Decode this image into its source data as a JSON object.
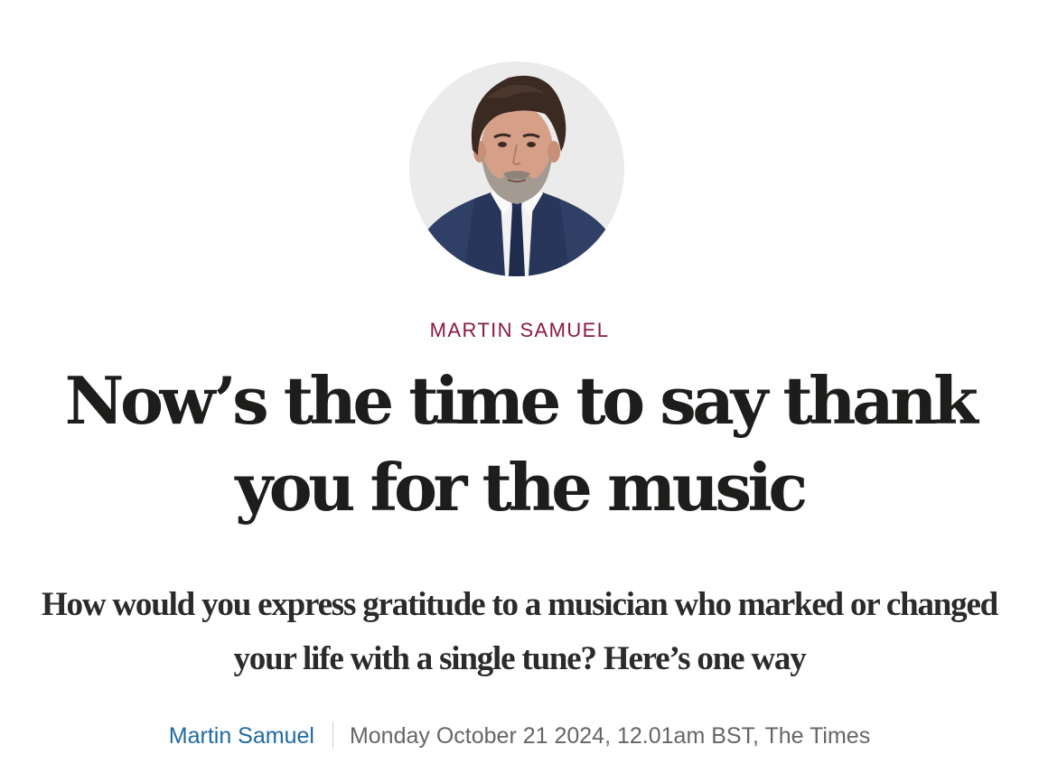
{
  "article": {
    "kicker": "MARTIN SAMUEL",
    "headline": "Now’s the time to say thank you for the music",
    "standfirst": "How would you express gratitude to a musician who marked or changed your life with a single tune? Here’s one way",
    "byline": {
      "author": "Martin Samuel",
      "dateline": "Monday October 21 2024, 12.01am BST, The Times"
    }
  },
  "colors": {
    "kicker": "#8b1a3c",
    "author_link": "#1f6aa5",
    "headline": "#1d1d1b",
    "avatar_bg": "#ebebeb"
  }
}
